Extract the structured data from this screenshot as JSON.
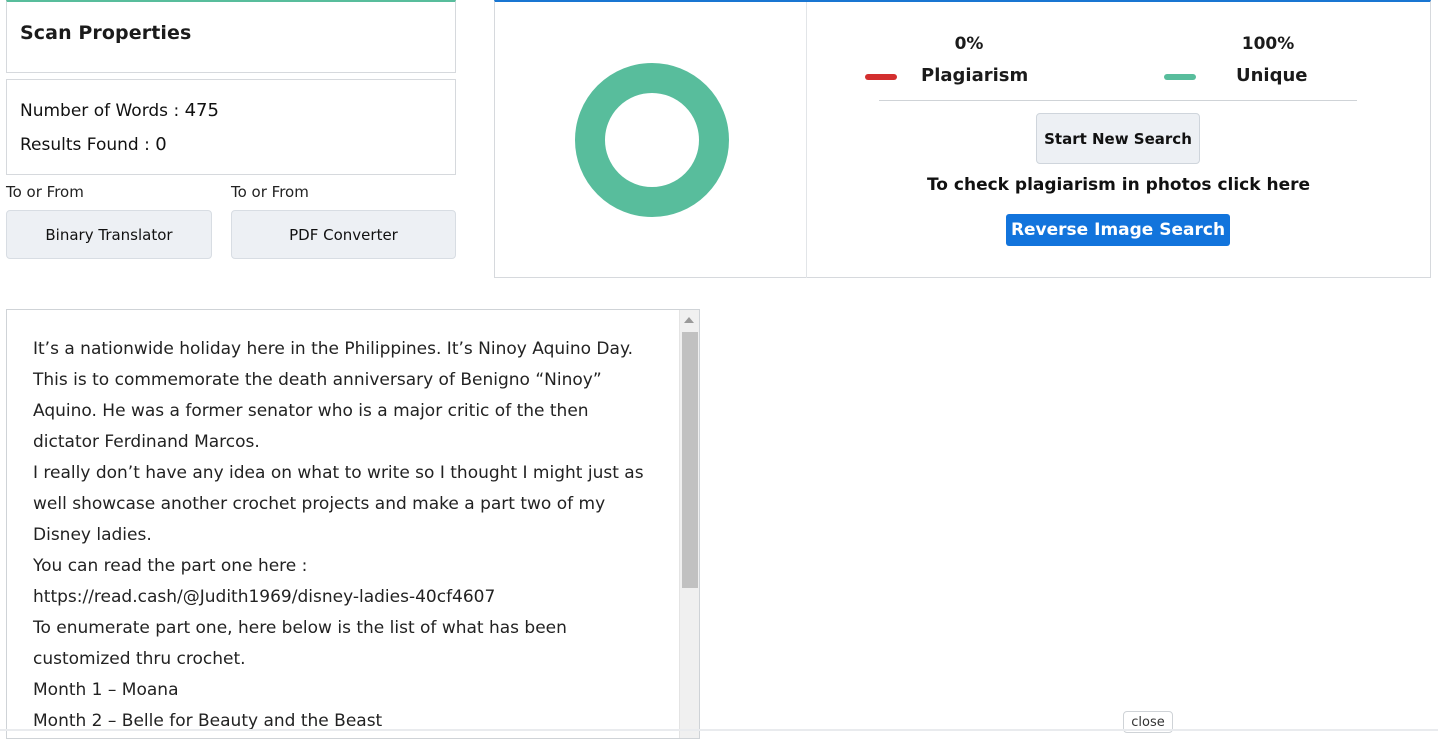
{
  "scan": {
    "title": "Scan Properties",
    "words_label": "Number of Words : ",
    "words_value": "475",
    "results_label": "Results Found : ",
    "results_value": "0"
  },
  "tools": [
    {
      "caption": "To or From",
      "label": "Binary Translator"
    },
    {
      "caption": "To or From",
      "label": "PDF Converter"
    }
  ],
  "results": {
    "plagiarism_percent": "0%",
    "plagiarism_label": "Plagiarism",
    "unique_percent": "100%",
    "unique_label": "Unique",
    "plagiarism_fraction": 0,
    "unique_fraction": 1,
    "plagiarism_color": "#d32f2f",
    "unique_color": "#58bd9c",
    "start_new_search": "Start New Search",
    "photos_prompt": "To check plagiarism in photos click here",
    "reverse_image_search": "Reverse Image Search"
  },
  "text_lines": [
    "It’s a nationwide holiday here in the Philippines. It’s Ninoy Aquino Day.",
    "This is to commemorate the death anniversary of Benigno “Ninoy”",
    "Aquino. He was a former senator who is a major critic of the then",
    "dictator Ferdinand Marcos.",
    "I really don’t have any idea on what to write so I thought I might just as",
    "well showcase another crochet projects and make a part two of my",
    "Disney ladies.",
    "You can read the part one here :",
    "https://read.cash/@Judith1969/disney-ladies-40cf4607",
    "To enumerate part one, here below is the list of what has been",
    "customized thru crochet.",
    "Month 1 – Moana",
    "Month 2 – Belle for Beauty and the Beast"
  ],
  "close_label": "close"
}
